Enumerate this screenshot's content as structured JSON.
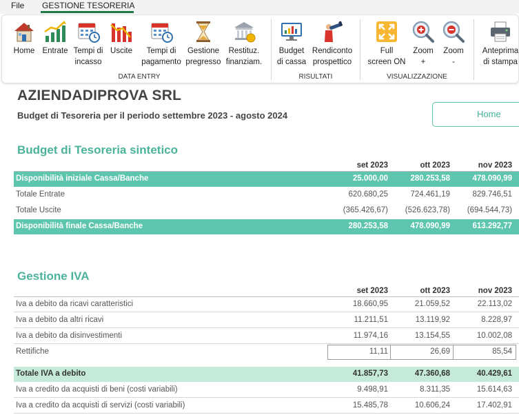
{
  "menubar": {
    "file": "File",
    "active_tab": "GESTIONE TESORERIA"
  },
  "ribbon": {
    "buttons": [
      {
        "id": "home",
        "label1": "Home",
        "label2": ""
      },
      {
        "id": "entrate",
        "label1": "Entrate",
        "label2": ""
      },
      {
        "id": "tempi-incasso",
        "label1": "Tempi di",
        "label2": "incasso"
      },
      {
        "id": "uscite",
        "label1": "Uscite",
        "label2": ""
      },
      {
        "id": "tempi-pagamento",
        "label1": "Tempi di",
        "label2": "pagamento"
      },
      {
        "id": "gestione-pregresso",
        "label1": "Gestione",
        "label2": "pregresso"
      },
      {
        "id": "restituz-finanziam",
        "label1": "Restituz.",
        "label2": "finanziam."
      },
      {
        "id": "budget-cassa",
        "label1": "Budget",
        "label2": "di cassa"
      },
      {
        "id": "rendiconto-prospettico",
        "label1": "Rendiconto",
        "label2": "prospettico"
      },
      {
        "id": "full-screen",
        "label1": "Full",
        "label2": "screen ON"
      },
      {
        "id": "zoom-in",
        "label1": "Zoom",
        "label2": "+"
      },
      {
        "id": "zoom-out",
        "label1": "Zoom",
        "label2": "-"
      },
      {
        "id": "anteprima-stampa",
        "label1": "Anteprima",
        "label2": "di stampa"
      }
    ],
    "groups": {
      "data_entry": "DATA ENTRY",
      "risultati": "RISULTATI",
      "visualizzazione": "VISUALIZZAZIONE"
    }
  },
  "page": {
    "company": "AZIENDADIPROVA SRL",
    "subtitle": "Budget di Tesoreria per il periodo settembre 2023 - agosto 2024",
    "home_button": "Home"
  },
  "sintetico": {
    "title": "Budget di Tesoreria sintetico",
    "months": [
      "set 2023",
      "ott 2023",
      "nov 2023"
    ],
    "rows": [
      {
        "label": "Disponibilità iniziale Cassa/Banche",
        "values": [
          "25.000,00",
          "280.253,58",
          "478.090,99"
        ]
      },
      {
        "label": "Totale Entrate",
        "values": [
          "620.680,25",
          "724.461,19",
          "829.746,51"
        ]
      },
      {
        "label": "Totale Uscite",
        "values": [
          "(365.426,67)",
          "(526.623,78)",
          "(694.544,73)"
        ]
      },
      {
        "label": "Disponibilità finale Cassa/Banche",
        "values": [
          "280.253,58",
          "478.090,99",
          "613.292,77"
        ]
      }
    ]
  },
  "iva": {
    "title": "Gestione IVA",
    "months": [
      "set 2023",
      "ott 2023",
      "nov 2023"
    ],
    "rows": [
      {
        "label": "Iva a debito da ricavi caratteristici",
        "values": [
          "18.660,95",
          "21.059,52",
          "22.113,02"
        ]
      },
      {
        "label": "Iva a debito da altri ricavi",
        "values": [
          "11.211,51",
          "13.119,92",
          "8.228,97"
        ]
      },
      {
        "label": "Iva a debito da disinvestimenti",
        "values": [
          "11.974,16",
          "13.154,55",
          "10.002,08"
        ]
      },
      {
        "label": "Rettifiche",
        "values": [
          "11,11",
          "26,69",
          "85,54"
        ]
      },
      {
        "label": "Totale IVA a debito",
        "values": [
          "41.857,73",
          "47.360,68",
          "40.429,61"
        ]
      },
      {
        "label": "Iva a credito da acquisti di beni (costi variabili)",
        "values": [
          "9.498,91",
          "8.311,35",
          "15.614,63"
        ]
      },
      {
        "label": "Iva a credito da acquisti di servizi (costi variabili)",
        "values": [
          "15.485,78",
          "10.606,24",
          "17.402,91"
        ]
      }
    ]
  }
}
